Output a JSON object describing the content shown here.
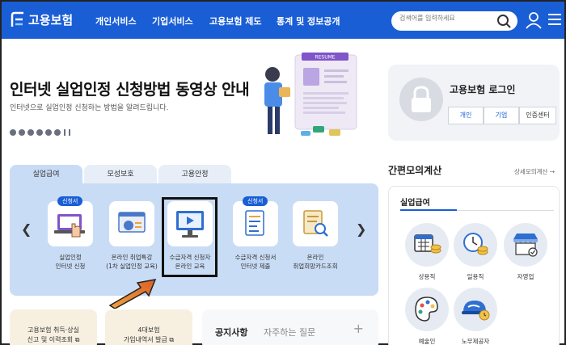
{
  "header": {
    "logo_text": "고용보험",
    "nav": [
      "개인서비스",
      "기업서비스",
      "고용보험 제도",
      "통계 및 정보공개"
    ],
    "search_placeholder": "검색어를 입력하세요",
    "brand_color": "#1a5ed6"
  },
  "hero": {
    "title": "인터넷 실업인정 신청방법 동영상 안내",
    "subtitle": "인터넷으로 실업인정 신청하는 방법을 알려드립니다.",
    "illustration_text": "RESUME"
  },
  "login": {
    "title": "고용보험 로그인",
    "buttons": [
      "개인",
      "기업",
      "인증센터"
    ]
  },
  "tabs": [
    "실업급여",
    "모성보호",
    "고용안정"
  ],
  "services": [
    {
      "badge": "신청서",
      "line1": "실업인정",
      "line2": "인터넷 신청"
    },
    {
      "badge": "",
      "line1": "온라인 취업특강",
      "line2": "(1차 실업인정 교육)"
    },
    {
      "badge": "",
      "line1": "수급자격 신청자",
      "line2": "온라인 교육"
    },
    {
      "badge": "신청서",
      "line1": "수급자격 신청서",
      "line2": "인터넷 제출"
    },
    {
      "badge": "",
      "line1": "온라인",
      "line2": "취업희망카드조회"
    }
  ],
  "quick_links": [
    {
      "line1": "고용보험 취득·상실",
      "line2": "신고 및 이력조회"
    },
    {
      "line1": "4대보험",
      "line2": "가입내역서 발급"
    }
  ],
  "notice": {
    "tab1": "공지사항",
    "tab2": "자주하는 질문",
    "plus": "+"
  },
  "calculator": {
    "title": "간편모의계산",
    "more": "상세모의계산 →",
    "sub": "실업급여",
    "items": [
      "상용직",
      "일용직",
      "자영업",
      "예술인",
      "노무제공자"
    ]
  }
}
